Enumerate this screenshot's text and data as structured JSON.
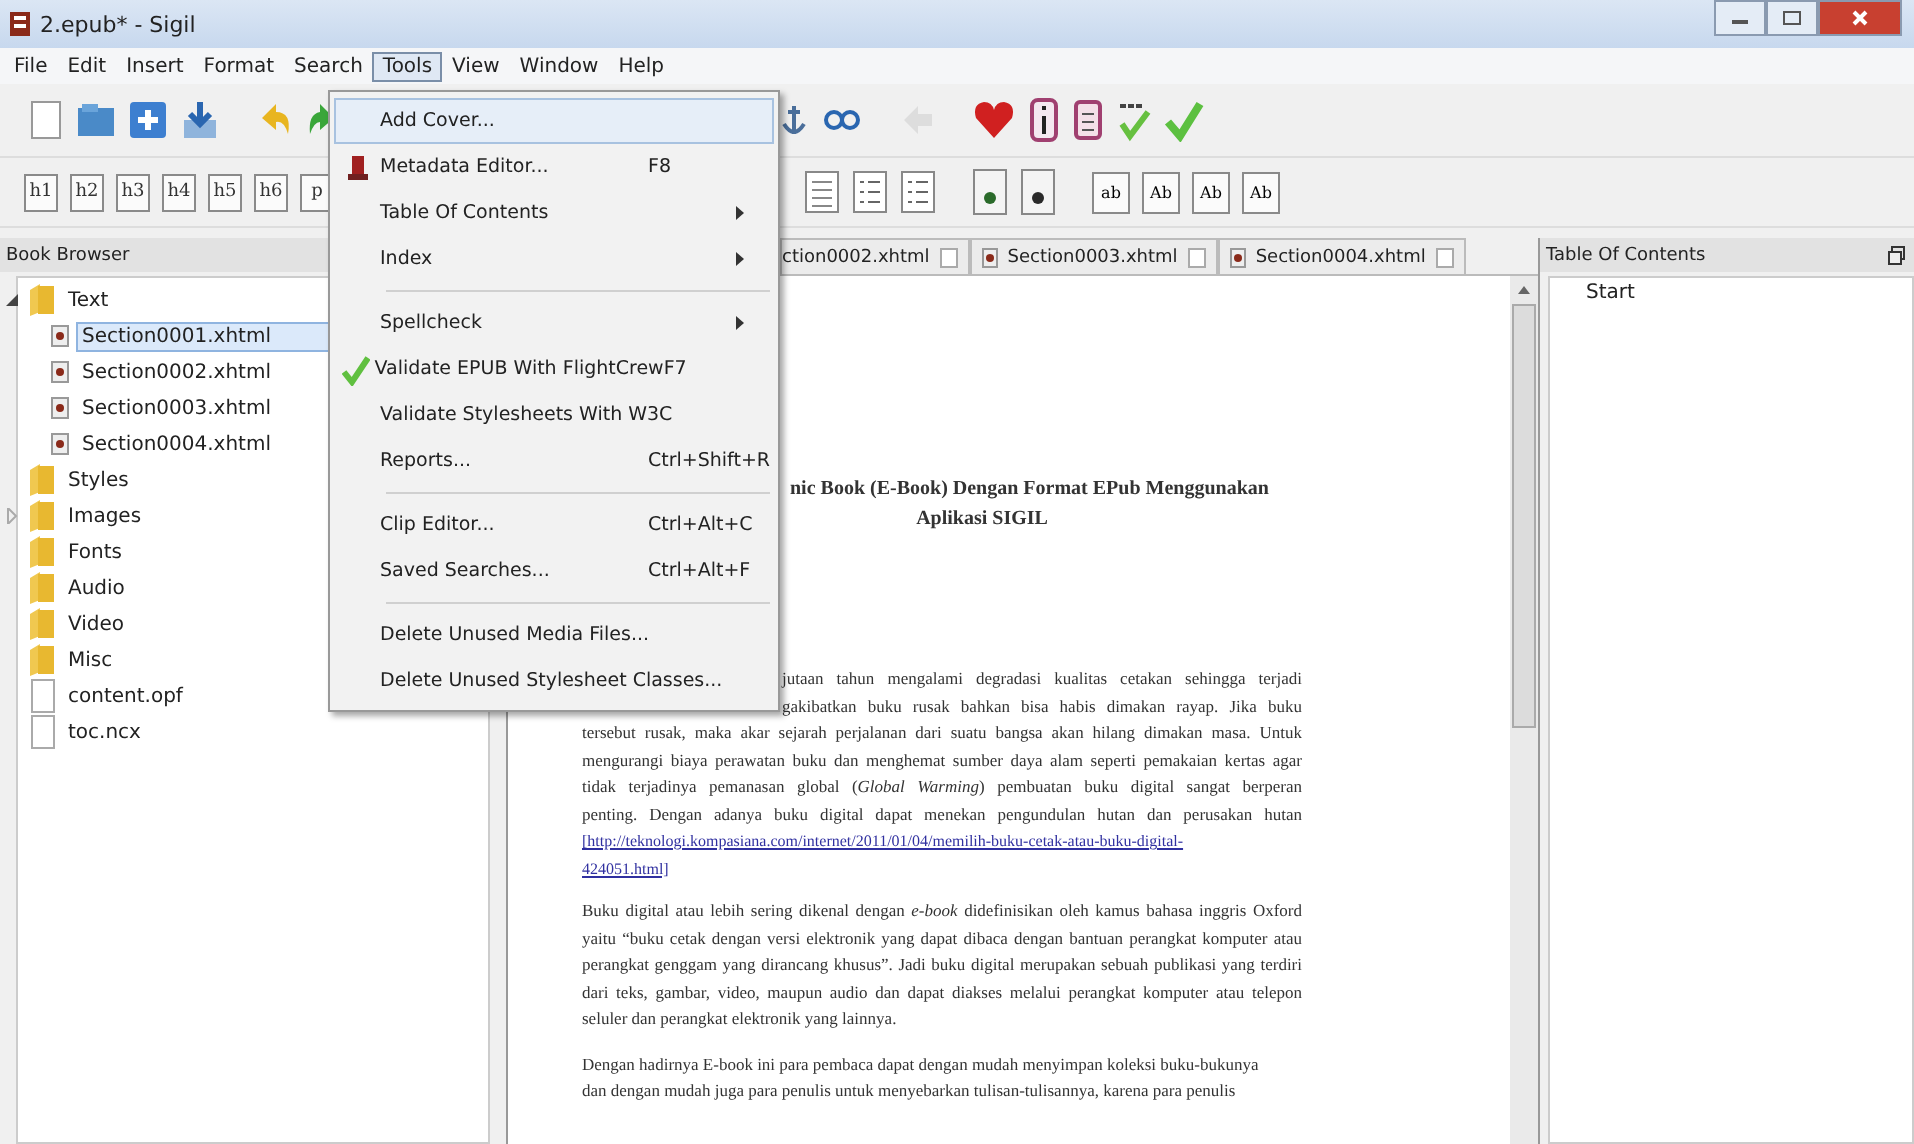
{
  "window": {
    "title": "2.epub* - Sigil"
  },
  "menu_bar": [
    {
      "label": "File",
      "selected": false
    },
    {
      "label": "Edit",
      "selected": false
    },
    {
      "label": "Insert",
      "selected": false
    },
    {
      "label": "Format",
      "selected": false
    },
    {
      "label": "Search",
      "selected": false
    },
    {
      "label": "Tools",
      "selected": true
    },
    {
      "label": "View",
      "selected": false
    },
    {
      "label": "Window",
      "selected": false
    },
    {
      "label": "Help",
      "selected": false
    }
  ],
  "heading_buttons": [
    "h1",
    "h2",
    "h3",
    "h4",
    "h5",
    "h6",
    "p"
  ],
  "style_buttons": [
    "ab",
    "Ab",
    "Ab",
    "Ab"
  ],
  "book_browser": {
    "title": "Book Browser",
    "items": [
      {
        "label": "Text",
        "kind": "folder",
        "expanded": true,
        "selected": false,
        "children": [
          {
            "label": "Section0001.xhtml",
            "selected": true
          },
          {
            "label": "Section0002.xhtml",
            "selected": false
          },
          {
            "label": "Section0003.xhtml",
            "selected": false
          },
          {
            "label": "Section0004.xhtml",
            "selected": false
          }
        ]
      },
      {
        "label": "Styles",
        "kind": "folder",
        "selected": false
      },
      {
        "label": "Images",
        "kind": "folder",
        "expanded": false,
        "selected": false
      },
      {
        "label": "Fonts",
        "kind": "folder",
        "selected": false
      },
      {
        "label": "Audio",
        "kind": "folder",
        "selected": false
      },
      {
        "label": "Video",
        "kind": "folder",
        "selected": false
      },
      {
        "label": "Misc",
        "kind": "folder",
        "selected": false
      },
      {
        "label": "content.opf",
        "kind": "file",
        "selected": false
      },
      {
        "label": "toc.ncx",
        "kind": "file",
        "selected": false
      }
    ]
  },
  "editor_tabs": [
    {
      "label": "ction0002.xhtml",
      "selected": false
    },
    {
      "label": "Section0003.xhtml",
      "selected": false
    },
    {
      "label": "Section0004.xhtml",
      "selected": false
    }
  ],
  "document": {
    "heading": [
      "nic Book (E-Book) Dengan Format EPub Menggunakan",
      "Aplikasi SIGIL"
    ],
    "paragraph_1_lines": [
      {
        "text": "jutaan tahun mengalami degradasi  kualitas cetakan sehingga  terjadi",
        "kind": "partial"
      },
      {
        "text": "gakibatkan buku rusak bahkan bisa habis dimakan rayap. Jika buku",
        "kind": "partial"
      },
      {
        "text": "tersebut rusak, maka akar sejarah perjalanan dari suatu bangsa akan hilang dimakan masa. Untuk",
        "kind": "full"
      },
      {
        "text": "mengurangi biaya perawatan buku dan menghemat sumber daya alam seperti pemakaian kertas agar",
        "kind": "full"
      },
      {
        "text": "tidak terjadinya pemanasan global (*Global Warming*) pembuatan buku digital sangat berperan",
        "kind": "full"
      },
      {
        "text": "penting. Dengan adanya buku digital dapat menekan pengundulan hutan  dan perusakan hutan",
        "kind": "full"
      },
      {
        "text": "[http://teknologi.kompasiana.com/internet/2011/01/04/memilih-buku-cetak-atau-buku-digital-",
        "kind": "link"
      },
      {
        "text": "424051.html]",
        "kind": "link"
      }
    ],
    "paragraph_2": "Buku digital atau lebih sering dikenal dengan *e-book* didefinisikan oleh kamus bahasa inggris Oxford yaitu “buku cetak dengan versi elektronik yang dapat dibaca dengan bantuan perangkat komputer atau perangkat genggam yang dirancang khusus”. Jadi buku digital merupakan sebuah publikasi yang terdiri dari teks, gambar, video, maupun audio dan dapat diakses melalui perangkat komputer atau telepon seluler dan perangkat elektronik yang lainnya.",
    "paragraph_3": [
      "Dengan hadirnya E-book ini para pembaca dapat dengan mudah menyimpan koleksi buku-bukunya",
      "dan dengan  mudah juga para penulis untuk menyebarkan tulisan-tulisannya, karena para penulis"
    ]
  },
  "table_of_contents": {
    "title": "Table Of Contents",
    "items": [
      "Start"
    ]
  },
  "tools_menu": [
    {
      "kind": "item",
      "label": "Add Cover...",
      "selected": true
    },
    {
      "kind": "item",
      "label": "Metadata Editor...",
      "shortcut": "F8",
      "selected": false
    },
    {
      "kind": "item",
      "label": "Table Of Contents",
      "submenu": true,
      "selected": false
    },
    {
      "kind": "item",
      "label": "Index",
      "submenu": true,
      "selected": false
    },
    {
      "kind": "separator"
    },
    {
      "kind": "item",
      "label": "Spellcheck",
      "submenu": true,
      "selected": false
    },
    {
      "kind": "item",
      "label": "Validate EPUB With FlightCrew",
      "shortcut": "F7",
      "selected": false
    },
    {
      "kind": "item",
      "label": "Validate Stylesheets With W3C",
      "selected": false
    },
    {
      "kind": "item",
      "label": "Reports...",
      "shortcut": "Ctrl+Shift+R",
      "selected": false
    },
    {
      "kind": "separator"
    },
    {
      "kind": "item",
      "label": "Clip Editor...",
      "shortcut": "Ctrl+Alt+C",
      "selected": false
    },
    {
      "kind": "item",
      "label": "Saved Searches...",
      "shortcut": "Ctrl+Alt+F",
      "selected": false
    },
    {
      "kind": "separator"
    },
    {
      "kind": "item",
      "label": "Delete Unused Media Files...",
      "selected": false
    },
    {
      "kind": "item",
      "label": "Delete Unused Stylesheet Classes...",
      "selected": false
    }
  ]
}
